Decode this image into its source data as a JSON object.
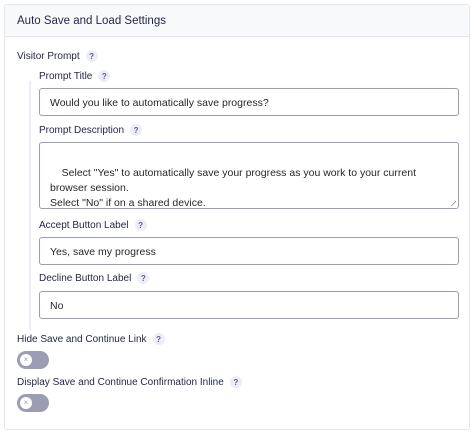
{
  "panel": {
    "title": "Auto Save and Load Settings"
  },
  "visitor_prompt": {
    "label": "Visitor Prompt",
    "help": "?",
    "prompt_title": {
      "label": "Prompt Title",
      "help": "?",
      "value": "Would you like to automatically save progress?"
    },
    "prompt_description": {
      "label": "Prompt Description",
      "help": "?",
      "value": "Select \"Yes\" to automatically save your progress as you work to your current browser session.\nSelect \"No\" if on a shared device."
    },
    "accept_button": {
      "label": "Accept Button Label",
      "help": "?",
      "value": "Yes, save my progress"
    },
    "decline_button": {
      "label": "Decline Button Label",
      "help": "?",
      "value": "No"
    }
  },
  "hide_save_continue": {
    "label": "Hide Save and Continue Link",
    "help": "?",
    "enabled": false,
    "knob_symbol": "×"
  },
  "display_inline": {
    "label": "Display Save and Continue Confirmation Inline",
    "help": "?",
    "enabled": false,
    "knob_symbol": "×"
  },
  "colors": {
    "border": "#e3e6ef",
    "input_border": "#9b9eb3",
    "toggle_off": "#9b9eb3",
    "help_bg": "#ecedf8"
  }
}
